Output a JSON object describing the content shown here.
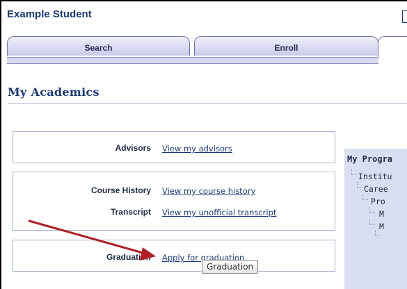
{
  "header": {
    "student_name": "Example Student"
  },
  "tabs": [
    {
      "label": "Search"
    },
    {
      "label": "Enroll"
    },
    {
      "label": ""
    }
  ],
  "page": {
    "title": "My Academics"
  },
  "panels": {
    "advisors": {
      "label": "Advisors",
      "link": "View my advisors"
    },
    "course_history": {
      "label": "Course History",
      "link": "View my course history"
    },
    "transcript": {
      "label": "Transcript",
      "link": "View my unofficial transcript"
    },
    "graduation": {
      "label": "Graduation",
      "link": "Apply for graduation"
    }
  },
  "graduation_button": {
    "label": "Graduation"
  },
  "program_panel": {
    "title": "My Progra",
    "tree": [
      "Institu",
      "Caree",
      "Pro",
      "M",
      "M",
      ""
    ]
  },
  "annotation": {
    "arrow_color": "#b21f24"
  }
}
